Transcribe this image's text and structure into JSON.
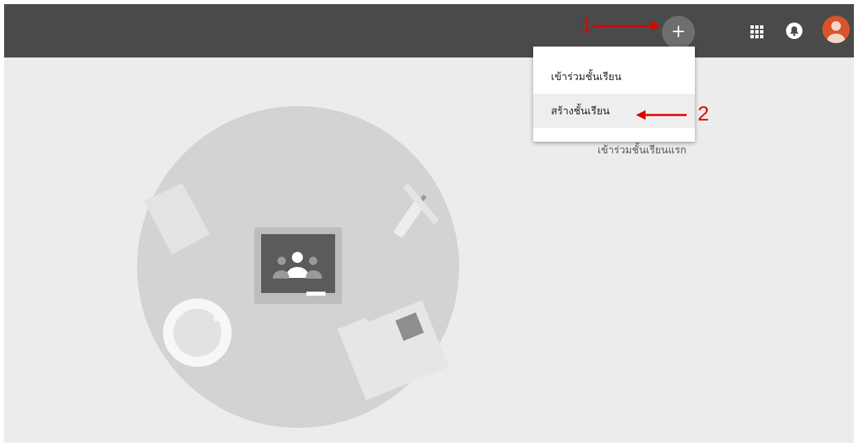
{
  "header": {
    "add_label": "+"
  },
  "menu": {
    "items": [
      {
        "label": "เข้าร่วมชั้นเรียน"
      },
      {
        "label": "สร้างชั้นเรียน"
      }
    ]
  },
  "empty_state": {
    "link_text": "เข้าร่วมชั้นเรียนแรก"
  },
  "annotations": {
    "step1": "1",
    "step2": "2"
  },
  "colors": {
    "topbar": "#4a4a4a",
    "background": "#ececec",
    "annotation": "#e00000",
    "avatar": "#d9532b"
  },
  "icons": [
    "plus-icon",
    "apps-grid-icon",
    "bell-icon",
    "user-avatar-icon",
    "google-classroom-icon"
  ]
}
